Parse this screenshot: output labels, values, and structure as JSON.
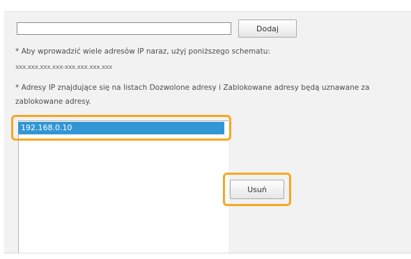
{
  "form": {
    "ip_input_value": "",
    "add_button_label": "Dodaj",
    "note_multiple": "* Aby wprowadzić wiele adresów IP naraz, użyj poniższego schematu:",
    "pattern": "xxx.xxx.xxx.xxx-xxx.xxx.xxx.xxx",
    "note_conflict": "* Adresy IP znajdujące się na listach Dozwolone adresy i Zablokowane adresy będą uznawane za zablokowane adresy."
  },
  "address_list": {
    "items": [
      "192.168.0.10"
    ],
    "selected_index": 0
  },
  "remove_button_label": "Usuń",
  "colors": {
    "highlight": "#f6a623",
    "selection": "#3296d4",
    "panel": "#f2f2f2"
  }
}
